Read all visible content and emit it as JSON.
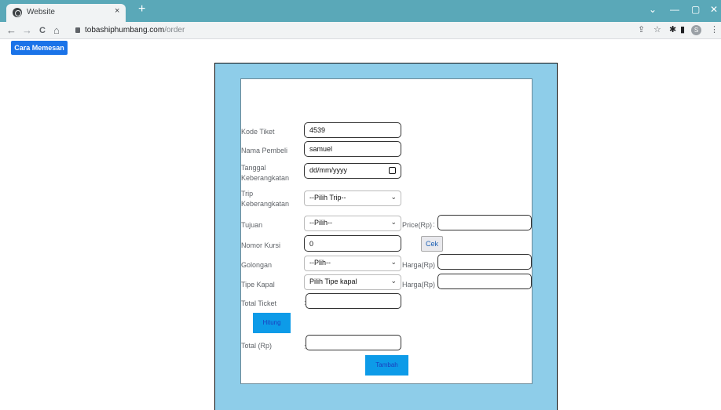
{
  "browser": {
    "tab_title": "Website",
    "tab_close": "×",
    "new_tab": "+",
    "url_host": "tobashiphumbang.com",
    "url_path": "/order",
    "nav": {
      "back": "←",
      "forward": "→",
      "reload": "C",
      "home": "⌂"
    },
    "window_controls": {
      "minimize": "—",
      "maximize": "▢",
      "close": "✕",
      "tab_search": "⌄"
    },
    "toolbar_icons": {
      "share": "⇪",
      "bookmark": "☆",
      "extensions": "✱",
      "sidepanel": "▮",
      "profile": "S",
      "menu": "⋮"
    }
  },
  "page": {
    "cara_memesan_label": "Cara Memesan",
    "form": {
      "kode_tiket": {
        "label": "Kode Tiket",
        "value": "4539"
      },
      "nama_pembeli": {
        "label": "Nama Pembeli",
        "value": "samuel"
      },
      "tanggal": {
        "label": "Tanggal Keberangkatan",
        "placeholder": "dd/mm/yyyy"
      },
      "trip": {
        "label": "Trip Keberangkatan",
        "selected": "--Pilih Trip--"
      },
      "tujuan": {
        "label": "Tujuan",
        "selected": "--Pilih--",
        "price_label": "Price(Rp)",
        "price_value": ""
      },
      "nomor_kursi": {
        "label": "Nomor Kursi",
        "value": "0",
        "cek_label": "Cek"
      },
      "golongan": {
        "label": "Golongan",
        "selected": "--Plih--",
        "harga_label": "Harga(Rp)",
        "harga_value": ""
      },
      "tipe_kapal": {
        "label": "Tipe Kapal",
        "selected": "Pilih Tipe kapal",
        "harga_label": "Harga(Rp)",
        "harga_value": ""
      },
      "total_ticket": {
        "label": "Total Ticket",
        "value": ""
      },
      "hitung_label": "Hitung",
      "total_rp": {
        "label": "Total (Rp)",
        "value": ""
      },
      "tambah_label": "Tambah",
      "colon": ":"
    }
  }
}
